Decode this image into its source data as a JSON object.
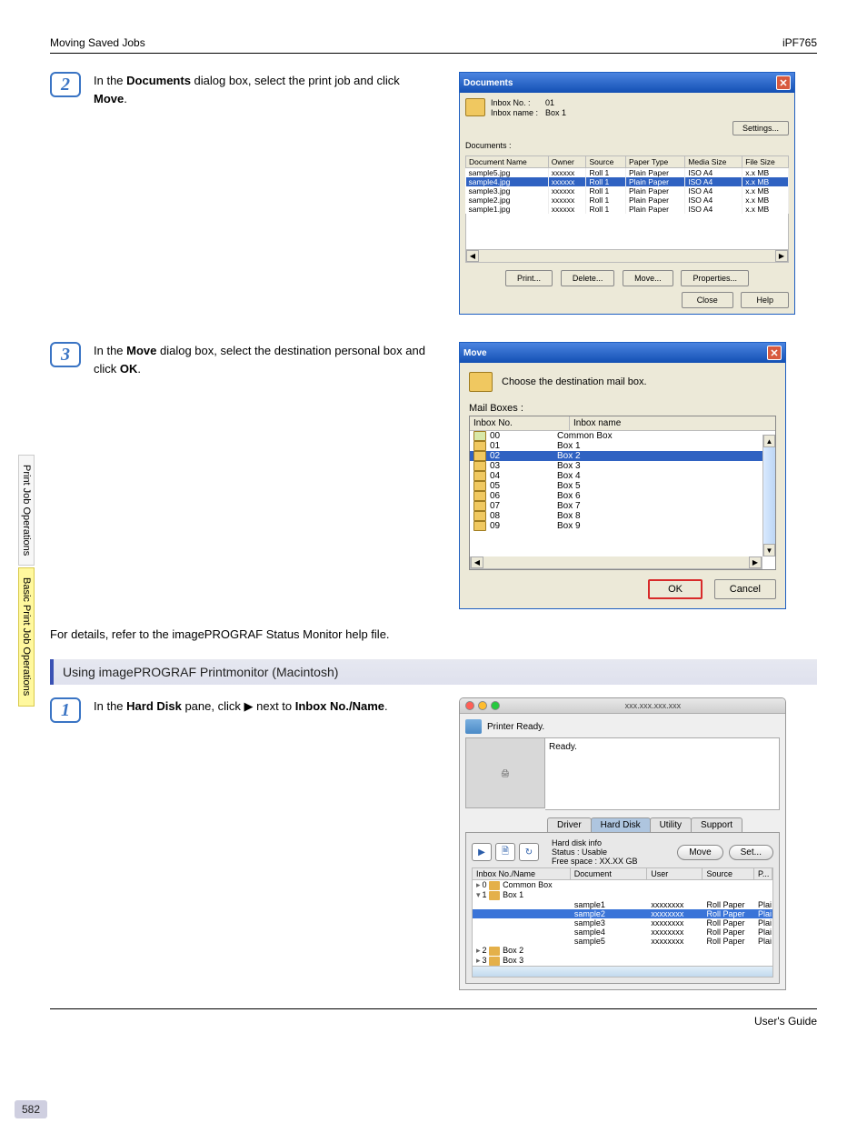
{
  "header": {
    "left": "Moving Saved Jobs",
    "right": "iPF765"
  },
  "side_tabs": {
    "tab1": "Print Job Operations",
    "tab2": "Basic Print Job Operations"
  },
  "steps": {
    "s2": {
      "num": "2",
      "t1": "In the ",
      "b1": "Documents",
      "t2": " dialog box, select the print job and click ",
      "b2": "Move",
      "t3": "."
    },
    "s3": {
      "num": "3",
      "t1": "In the ",
      "b1": "Move",
      "t2": " dialog box, select the destination personal box and click ",
      "b2": "OK",
      "t3": "."
    },
    "s1": {
      "num": "1",
      "t1": "In the ",
      "b1": "Hard Disk",
      "t2": " pane, click ",
      "icon": "▶",
      "t3": " next to ",
      "b2": "Inbox No./Name",
      "t4": "."
    }
  },
  "documents_dialog": {
    "title": "Documents",
    "inbox_no_label": "Inbox No. :",
    "inbox_no_val": "01",
    "inbox_name_label": "Inbox name :",
    "inbox_name_val": "Box 1",
    "settings_btn": "Settings...",
    "docs_label": "Documents :",
    "cols": {
      "c1": "Document Name",
      "c2": "Owner",
      "c3": "Source",
      "c4": "Paper Type",
      "c5": "Media Size",
      "c6": "File Size"
    },
    "rows": [
      {
        "n": "sample5.jpg",
        "o": "xxxxxx",
        "s": "Roll 1",
        "p": "Plain Paper",
        "m": "ISO A4",
        "f": "x.x MB",
        "sel": false
      },
      {
        "n": "sample4.jpg",
        "o": "xxxxxx",
        "s": "Roll 1",
        "p": "Plain Paper",
        "m": "ISO A4",
        "f": "x.x MB",
        "sel": true
      },
      {
        "n": "sample3.jpg",
        "o": "xxxxxx",
        "s": "Roll 1",
        "p": "Plain Paper",
        "m": "ISO A4",
        "f": "x.x MB",
        "sel": false
      },
      {
        "n": "sample2.jpg",
        "o": "xxxxxx",
        "s": "Roll 1",
        "p": "Plain Paper",
        "m": "ISO A4",
        "f": "x.x MB",
        "sel": false
      },
      {
        "n": "sample1.jpg",
        "o": "xxxxxx",
        "s": "Roll 1",
        "p": "Plain Paper",
        "m": "ISO A4",
        "f": "x.x MB",
        "sel": false
      }
    ],
    "buttons": {
      "print": "Print...",
      "delete": "Delete...",
      "move": "Move...",
      "properties": "Properties...",
      "close": "Close",
      "help": "Help"
    }
  },
  "move_dialog": {
    "title": "Move",
    "choose_label": "Choose the destination mail box.",
    "mail_label": "Mail Boxes :",
    "head": {
      "c1": "Inbox No.",
      "c2": "Inbox name"
    },
    "rows": [
      {
        "no": "00",
        "name": "Common Box",
        "sel": false,
        "cls": "common"
      },
      {
        "no": "01",
        "name": "Box 1",
        "sel": false,
        "cls": "locked"
      },
      {
        "no": "02",
        "name": "Box 2",
        "sel": true,
        "cls": ""
      },
      {
        "no": "03",
        "name": "Box 3",
        "sel": false,
        "cls": ""
      },
      {
        "no": "04",
        "name": "Box 4",
        "sel": false,
        "cls": ""
      },
      {
        "no": "05",
        "name": "Box 5",
        "sel": false,
        "cls": ""
      },
      {
        "no": "06",
        "name": "Box 6",
        "sel": false,
        "cls": ""
      },
      {
        "no": "07",
        "name": "Box 7",
        "sel": false,
        "cls": ""
      },
      {
        "no": "08",
        "name": "Box 8",
        "sel": false,
        "cls": ""
      },
      {
        "no": "09",
        "name": "Box 9",
        "sel": false,
        "cls": ""
      }
    ],
    "ok": "OK",
    "cancel": "Cancel"
  },
  "detail_note": "For details, refer to the imagePROGRAF Status Monitor help file.",
  "section_head": "Using imagePROGRAF Printmonitor (Macintosh)",
  "mac": {
    "addr": "xxx.xxx.xxx.xxx",
    "ready_label": "Printer Ready.",
    "status_text": "Ready.",
    "tabs": {
      "driver": "Driver",
      "hard": "Hard Disk",
      "utility": "Utility",
      "support": "Support"
    },
    "info": {
      "l1": "Hard disk info",
      "l2": "Status : Usable",
      "l3": "Free space : XX.XX GB"
    },
    "move_btn": "Move",
    "set_btn": "Set...",
    "head": {
      "c1": "Inbox No./Name",
      "c2": "Document",
      "c3": "User",
      "c4": "Source",
      "c5": "P..."
    },
    "tree": {
      "r0": "0",
      "r0n": "Common Box",
      "r1": "1",
      "r1n": "Box 1",
      "r2": "2",
      "r2n": "Box 2",
      "r3": "3",
      "r3n": "Box 3"
    },
    "docs": [
      {
        "d": "sample1",
        "u": "xxxxxxxx",
        "s": "Roll Paper",
        "p": "Plai",
        "sel": false
      },
      {
        "d": "sample2",
        "u": "xxxxxxxx",
        "s": "Roll Paper",
        "p": "Plai",
        "sel": true
      },
      {
        "d": "sample3",
        "u": "xxxxxxxx",
        "s": "Roll Paper",
        "p": "Plai",
        "sel": false
      },
      {
        "d": "sample4",
        "u": "xxxxxxxx",
        "s": "Roll Paper",
        "p": "Plai",
        "sel": false
      },
      {
        "d": "sample5",
        "u": "xxxxxxxx",
        "s": "Roll Paper",
        "p": "Plai",
        "sel": false
      }
    ]
  },
  "page_number": "582",
  "footer": "User's Guide"
}
